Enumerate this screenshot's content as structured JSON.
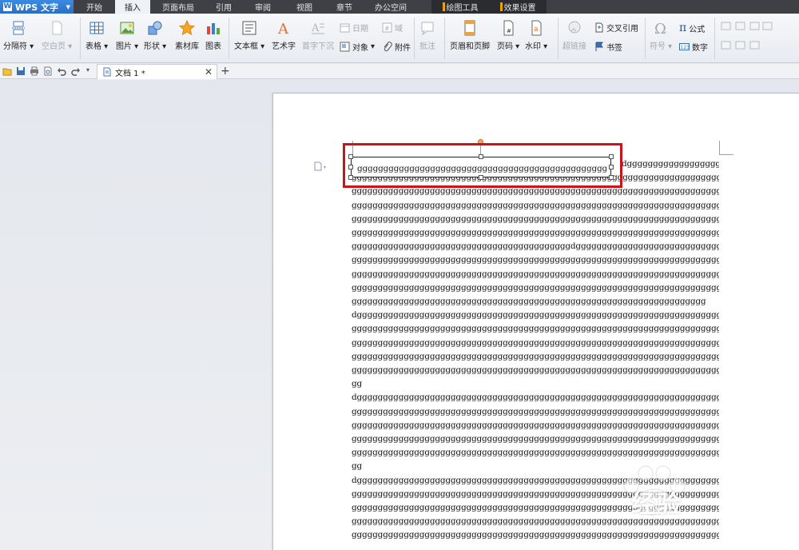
{
  "app": {
    "name": "WPS 文字"
  },
  "menu_tabs": [
    "开始",
    "插入",
    "页面布局",
    "引用",
    "审阅",
    "视图",
    "章节",
    "办公空间"
  ],
  "context_tabs": [
    "绘图工具",
    "效果设置"
  ],
  "active_tab": "插入",
  "ribbon": {
    "page_break": "分隔符",
    "blank_page": "空白页",
    "table": "表格",
    "picture": "图片",
    "shape": "形状",
    "material": "素材库",
    "chart": "图表",
    "textbox": "文本框",
    "wordart": "艺术字",
    "dropcap": "首字下沉",
    "date": "日期",
    "field": "域",
    "object": "对象",
    "attachment": "附件",
    "comment": "批注",
    "header_footer": "页眉和页脚",
    "page_number": "页码",
    "watermark": "水印",
    "hyperlink": "超链接",
    "cross_ref": "交叉引用",
    "bookmark": "书签",
    "symbol": "符号",
    "formula": "公式",
    "number": "数字",
    "formula_symbol": "π"
  },
  "document_tab": {
    "title": "文档 1 *"
  },
  "textbox": {
    "text": "gggggggggggggggggggggggggggggggggggggggggggggggggggggggg"
  },
  "body_lines": [
    "dgggggggggggggggggg",
    "gggggggggggggggggggggggggggggggggggggggggggggggggggggggggggggggggggggggggggggggg",
    "gggggggggggggggggggggggggggggggggggggggggggggggggggggggggggggggggggggggggggggggg",
    "gggggggggggggggggggggggggggggggggggggggggggggggggggggggggggggggggggggggggggggggg",
    "gggggggggggggggggggggggggggggggggggggggggggggggggggggggggggggggggggggggggggggggg",
    "gggggggggggggggggggggggggggggggggggggggggggggggggggggggggggggggggggggggggggggggg",
    "ggggggggggggggggggggggggggggggggggggggggggdggggggggggggggggggggggggggggggggggggg",
    "gggggggggggggggggggggggggggggggggggggggggggggggggggggggggggggggggggggggggggggggg",
    "gggggggggggggggggggggggggggggggggggggggggggggggggggggggggggggggggggggggggggggggg",
    "gggggggggggggggggggggggggggggggggggggggggggggggggggggggggggggggggggggggggggggggg",
    "gggggggggggggggggggggggggggggggggggggggggggggggggggggggggggggggggggg",
    "dggggggggggggggggggggggggggggggggggggggggggggggggggggggggggggggggggggggggggggggg",
    "gggggggggggggggggggggggggggggggggggggggggggggggggggggggggggggggggggggggggggggggg",
    "gggggggggggggggggggggggggggggggggggggggggggggggggggggggggggggggggggggggggggggggg",
    "gggggggggggggggggggggggggggggggggggggggggggggggggggggggggggggggggggggggggggggggg",
    "gggggggggggggggggggggggggggggggggggggggggggggggggggggggggggggggggggggggggggggggg",
    "gg",
    "dggggggggggggggggggggggggggggggggggggggggggggggggggggggggggggggggggggggggggggggg",
    "gggggggggggggggggggggggggggggggggggggggggggggggggggggggggggggggggggggggggggggggg",
    "gggggggggggggggggggggggggggggggggggggggggggggggggggggggggggggggggggggggggggggggg",
    "gggggggggggggggggggggggggggggggggggggggggggggggggggggggggggggggggggggggggggggggg",
    "gggggggggggggggggggggggggggggggggggggggggggggggggggggggggggggggggggggggggggggggg",
    "gg",
    "dggggggggggggggggggggggggggggggggggggggggggggggggggggggggggggggggggggggggggggggg",
    "gggggggggggggggggggggggggggggggggggggggggggggggggggggggggggggggggggggggggggggggg",
    "gggggggggggggggggggggggggggggggggggggggggggggggggggggggggggggggggggggggggggggggg",
    "gggggggggggggggggggggggggggggggggggggggggggggggggggggggggggggggggggggggggggggggg",
    "gggggggggggggggggggggggggggggggggggggggggggggggggggggggggggggggggggggggggggggggg"
  ],
  "watermark_text": "经验",
  "colors": {
    "accent": "#2b6fc4",
    "highlight": "#c8151b",
    "context_mark": "#f0a200"
  }
}
